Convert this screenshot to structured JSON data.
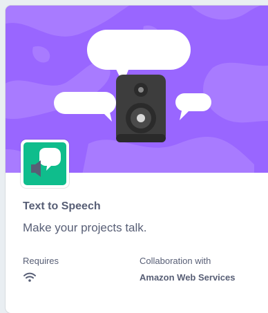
{
  "extension": {
    "title": "Text to Speech",
    "description": "Make your projects talk.",
    "requires_label": "Requires",
    "requires_icon": "wifi-icon",
    "collaboration_label": "Collaboration with",
    "collaborator": "Amazon Web Services",
    "icon": "speech-bubble-speaker-icon"
  },
  "colors": {
    "banner": "#9966ff",
    "icon_background": "#0fbd8c",
    "text": "#575e75"
  }
}
